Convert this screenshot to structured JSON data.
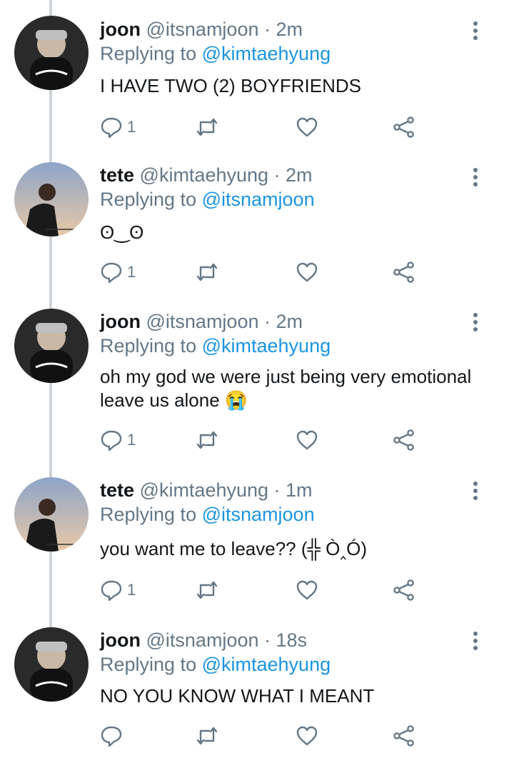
{
  "colors": {
    "accent": "#1b95e0",
    "muted": "#657786",
    "text": "#14171a",
    "thread": "#cfd4d8"
  },
  "tweets": [
    {
      "name": "joon",
      "handle": "@itsnamjoon",
      "time": "2m",
      "replying_label": "Replying to",
      "mention": "@kimtaehyung",
      "text": "I HAVE TWO (2) BOYFRIENDS",
      "reply_count": "1"
    },
    {
      "name": "tete",
      "handle": "@kimtaehyung",
      "time": "2m",
      "replying_label": "Replying to",
      "mention": "@itsnamjoon",
      "text": "ʘ‿ʘ",
      "reply_count": "1"
    },
    {
      "name": "joon",
      "handle": "@itsnamjoon",
      "time": "2m",
      "replying_label": "Replying to",
      "mention": "@kimtaehyung",
      "text": "oh my god we were just being very emotional leave us alone 😭",
      "reply_count": "1"
    },
    {
      "name": "tete",
      "handle": "@kimtaehyung",
      "time": "1m",
      "replying_label": "Replying to",
      "mention": "@itsnamjoon",
      "text": "you want me to leave?? (╬ Ò‸Ó)",
      "reply_count": "1"
    },
    {
      "name": "joon",
      "handle": "@itsnamjoon",
      "time": "18s",
      "replying_label": "Replying to",
      "mention": "@kimtaehyung",
      "text": "NO YOU KNOW WHAT I MEANT",
      "reply_count": ""
    }
  ],
  "icons": {
    "reply": "reply-icon",
    "retweet": "retweet-icon",
    "like": "heart-icon",
    "share": "share-icon",
    "more": "more-vertical-icon"
  }
}
